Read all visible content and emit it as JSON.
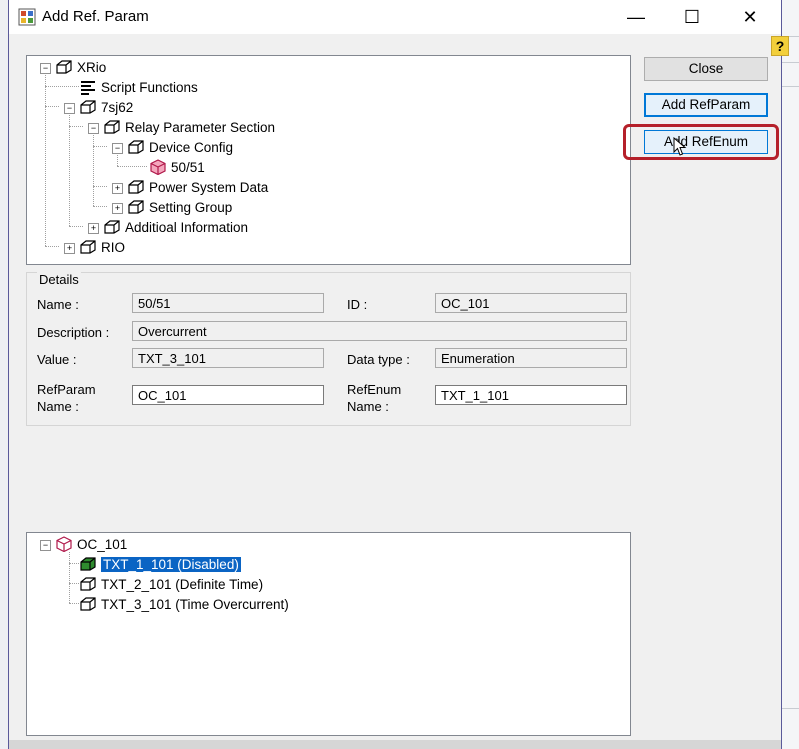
{
  "window": {
    "title": "Add Ref. Param",
    "minimize": "—",
    "maximize": "☐",
    "close": "✕"
  },
  "help": "?",
  "buttons": {
    "close": "Close",
    "add_refparam": "Add RefParam",
    "add_refenum": "Add RefEnum"
  },
  "tree_top": {
    "nodes": [
      {
        "label": "XRio",
        "expander": "−"
      },
      {
        "label": "Script Functions"
      },
      {
        "label": "7sj62",
        "expander": "−"
      },
      {
        "label": "Relay Parameter Section",
        "expander": "−"
      },
      {
        "label": "Device Config",
        "expander": "−"
      },
      {
        "label": "50/51"
      },
      {
        "label": "Power System Data",
        "expander": "+"
      },
      {
        "label": "Setting Group",
        "expander": "+"
      },
      {
        "label": "Additioal Information",
        "expander": "+"
      },
      {
        "label": "RIO",
        "expander": "+"
      }
    ]
  },
  "details": {
    "legend": "Details",
    "name_label": "Name :",
    "name_value": "50/51",
    "id_label": "ID :",
    "id_value": "OC_101",
    "description_label": "Description :",
    "description_value": "Overcurrent",
    "value_label": "Value :",
    "value_value": "TXT_3_101",
    "datatype_label": "Data type :",
    "datatype_value": "Enumeration",
    "refparam_label_1": "RefParam",
    "refparam_label_2": "Name :",
    "refparam_value": "OC_101",
    "refenum_label_1": "RefEnum",
    "refenum_label_2": "Name :",
    "refenum_value": "TXT_1_101"
  },
  "tree_bottom": {
    "root": {
      "label": "OC_101",
      "expander": "−"
    },
    "items": [
      {
        "label": "TXT_1_101 (Disabled)"
      },
      {
        "label": "TXT_2_101 (Definite Time)"
      },
      {
        "label": "TXT_3_101 (Time Overcurrent)"
      }
    ]
  },
  "colors": {
    "selection": "#0a64c4",
    "highlight_ring": "#b5202a",
    "help_badge": "#f2cf3b"
  }
}
